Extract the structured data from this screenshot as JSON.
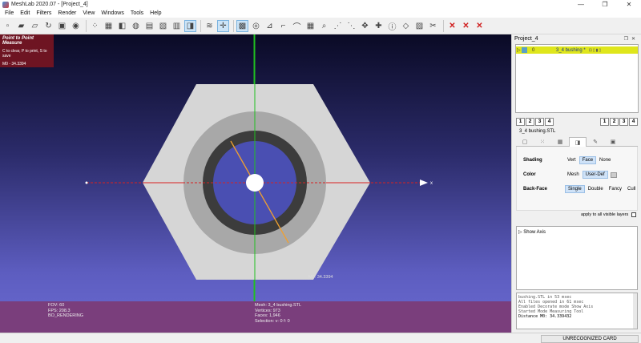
{
  "window": {
    "title": "MeshLab 2020.07 - [Project_4]",
    "controls": [
      "—",
      "❐",
      "✕"
    ]
  },
  "menu": [
    "File",
    "Edit",
    "Filters",
    "Render",
    "View",
    "Windows",
    "Tools",
    "Help"
  ],
  "measure_panel": {
    "title": "Point to Point Measure",
    "hint": "C to clear, P to print, S to save",
    "result": "M0 - 34.3394"
  },
  "viewport": {
    "distance_label": "M0: 34.3394",
    "axis_label": "x",
    "info_left": [
      "FOV: 60",
      "FPS:   208.3",
      "BO_RENDERING"
    ],
    "info_right": [
      "Mesh: 3_4 bushing.STL",
      "Vertices: 973",
      "Faces: 1,946",
      "Selection: v: 0 f: 0"
    ]
  },
  "right_panel": {
    "project_title": "Project_4",
    "layer": {
      "id": "0",
      "name": "3_4 bushing *"
    },
    "num_buttons_left": [
      "1",
      "2",
      "3",
      "4"
    ],
    "num_buttons_right": [
      "1",
      "2",
      "3",
      "4"
    ],
    "mesh_name": "3_4 bushing.STL",
    "shading": {
      "label": "Shading",
      "options": [
        "Vert",
        "Face",
        "None"
      ],
      "selected": "Face"
    },
    "color": {
      "label": "Color",
      "options": [
        "Mesh",
        "User-Def"
      ],
      "selected": "User-Def"
    },
    "backface": {
      "label": "Back-Face",
      "options": [
        "Single",
        "Double",
        "Fancy",
        "Cull"
      ],
      "selected": "Single"
    },
    "apply_label": "apply to all visible layers",
    "decorators": [
      "Show Axis"
    ],
    "log": [
      "bushing.STL in 53 msec",
      "All files opened in 61 msec",
      "Enabled Decorate mode Show Axis",
      "Started Mode Measuring Tool",
      "Distance M0: 34.339432"
    ]
  },
  "status": {
    "card": "UNRECOGNIZED CARD"
  },
  "colors": {
    "measure_panel_bg": "#6e1422",
    "info_band": "#7a3e7c",
    "layer_highlight": "#dfe61c",
    "x_axis": "#d82020",
    "y_axis": "#20c020",
    "measure_line": "#f0a030"
  }
}
